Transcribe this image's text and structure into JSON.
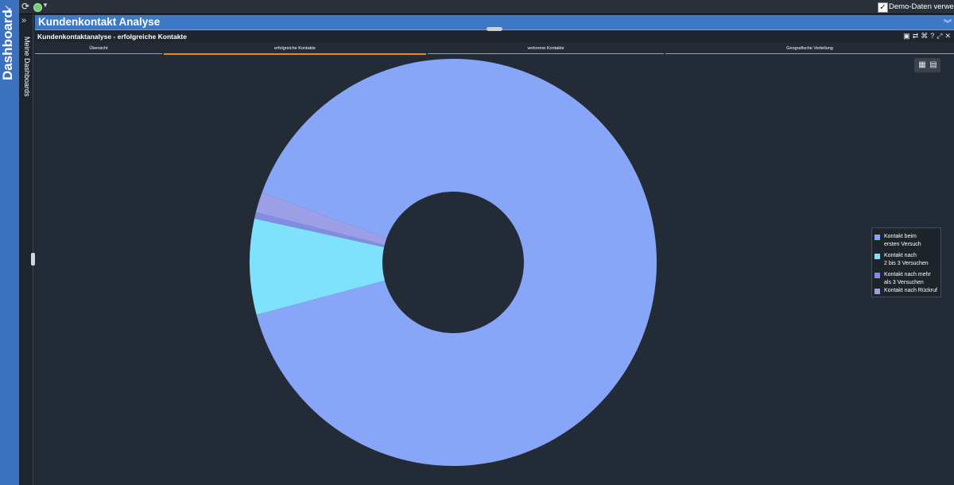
{
  "app": {
    "rail_title": "Dashboard",
    "my_dashboards": "Meine Dashboards"
  },
  "topbar": {
    "demo_data_label": "Demo-Daten verwenden",
    "demo_data_checked": true
  },
  "dashboard": {
    "title": "Kundenkontakt Analyse"
  },
  "panel": {
    "title": "Kundenkontaktanalyse - erfolgreiche Kontakte",
    "tools": [
      "copy-icon",
      "refresh-icon",
      "settings-icon",
      "help-icon",
      "maximize-icon",
      "close-icon"
    ]
  },
  "tabs": [
    {
      "label": "Übersicht",
      "active": false
    },
    {
      "label": "erfolgreiche Kontakte",
      "active": true
    },
    {
      "label": "verlorene Kontakte",
      "active": false
    },
    {
      "label": "Geografische Verteilung",
      "active": false
    }
  ],
  "colors": {
    "accent": "#3f79c6",
    "tab_active": "#e38b1d",
    "background": "#232c36"
  },
  "chart_data": {
    "type": "pie",
    "donut": true,
    "title": "",
    "series": [
      {
        "name": "Kontakt beim\nersten Versuch",
        "value": 90.3,
        "color": "#87a6f8"
      },
      {
        "name": "Kontakt nach\n2 bis 3 Versuchen",
        "value": 7.6,
        "color": "#7fe1fb"
      },
      {
        "name": "Kontakt nach mehr\nals 3 Versuchen",
        "value": 0.5,
        "color": "#7f8ee3"
      },
      {
        "name": "Kontakt nach Rückruf",
        "value": 1.6,
        "color": "#9d9fe6"
      }
    ],
    "legend_position": "right"
  }
}
